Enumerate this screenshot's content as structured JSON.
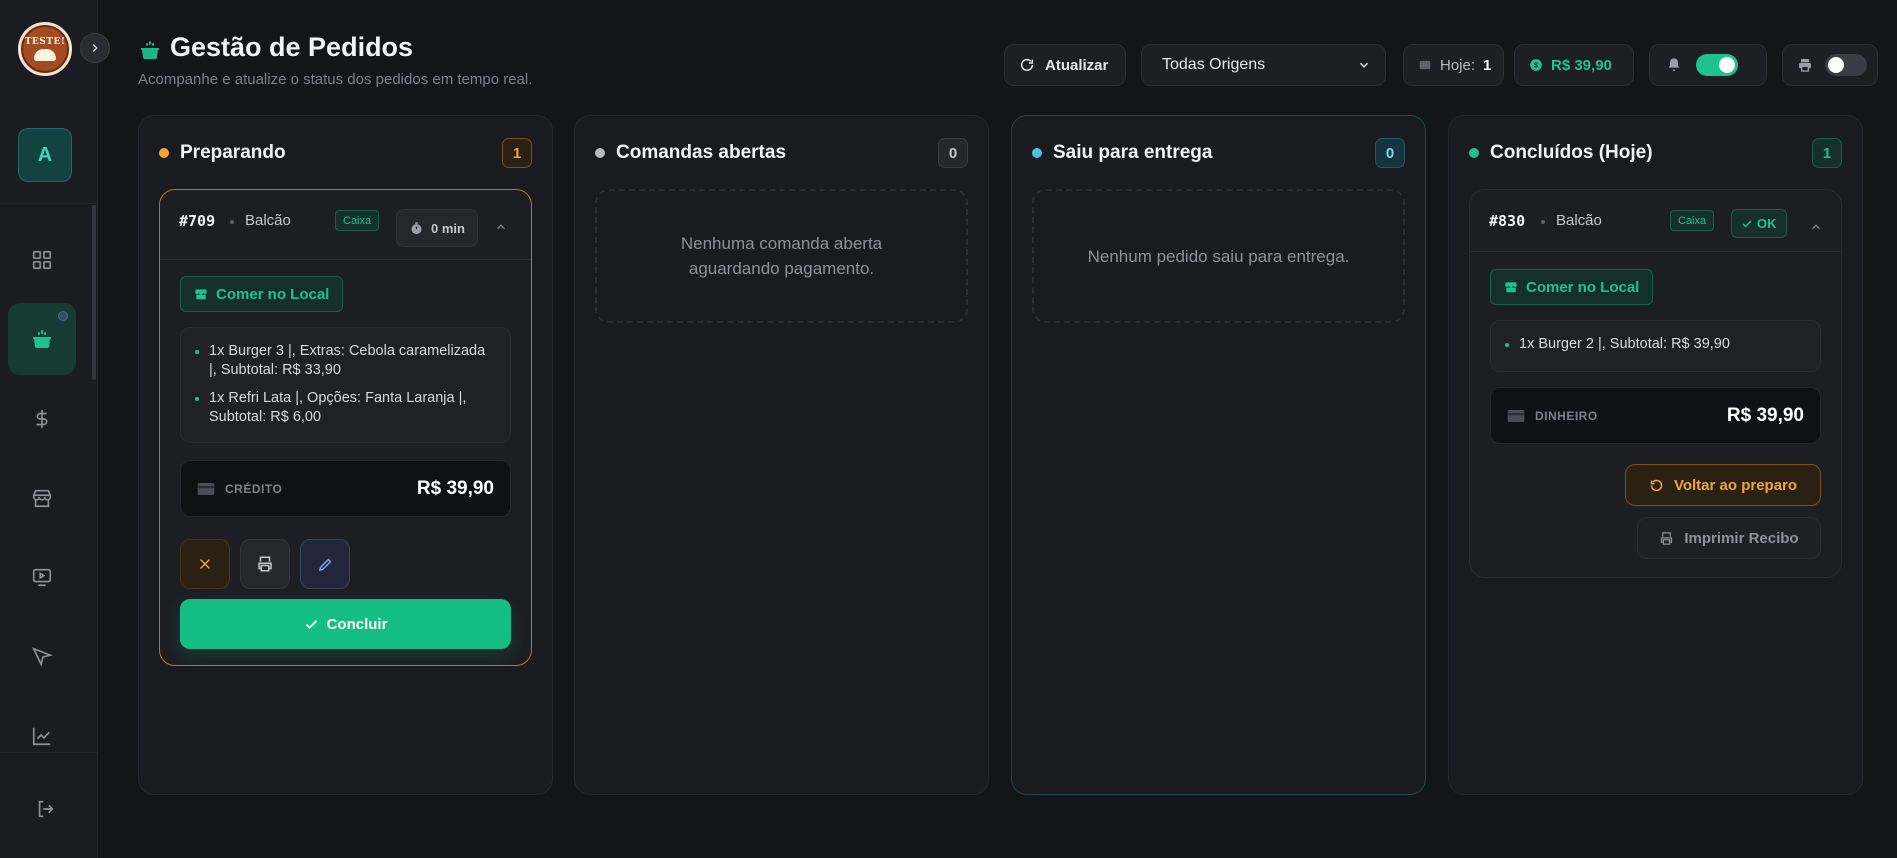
{
  "sidebar": {
    "logo_text": "TESTE!",
    "avatar_initial": "A",
    "nav_icons": [
      "grid-icon",
      "cooking-pot-icon",
      "dollar-icon",
      "store-icon",
      "tv-icon",
      "cursor-icon",
      "chart-icon"
    ],
    "logout_icon": "logout-icon"
  },
  "header": {
    "title": "Gestão de Pedidos",
    "subtitle": "Acompanhe e atualize o status dos pedidos em tempo real.",
    "refresh_label": "Atualizar",
    "origin_select": "Todas Origens",
    "today_label": "Hoje:",
    "today_count": "1",
    "revenue": "R$ 39,90",
    "notifications_enabled": true,
    "auto_print_enabled": false
  },
  "colors": {
    "accent": "#15be85",
    "preparing": "#f0a33a",
    "open": "#b6b9c1",
    "delivery": "#4fc0e0",
    "done": "#1ec28f"
  },
  "columns": {
    "preparing": {
      "title": "Preparando",
      "count": "1",
      "order": {
        "number": "#709",
        "origin": "Balcão",
        "tag": "Caixa",
        "timer": "0 min",
        "place": "Comer no Local",
        "items": [
          "1x Burger 3 |, Extras: Cebola caramelizada |, Subtotal: R$ 33,90",
          "1x Refri Lata |, Opções: Fanta Laranja |, Subtotal: R$ 6,00"
        ],
        "payment_method": "CRÉDITO",
        "total": "R$ 39,90",
        "conclude_label": "Concluir"
      }
    },
    "open_tabs": {
      "title": "Comandas abertas",
      "count": "0",
      "empty_text": "Nenhuma comanda aberta aguardando pagamento."
    },
    "delivery": {
      "title": "Saiu para entrega",
      "count": "0",
      "empty_text": "Nenhum pedido saiu para entrega."
    },
    "done": {
      "title": "Concluídos (Hoje)",
      "count": "1",
      "order": {
        "number": "#830",
        "origin": "Balcão",
        "tag": "Caixa",
        "status": "OK",
        "place": "Comer no Local",
        "items": [
          "1x Burger 2 |, Subtotal: R$ 39,90"
        ],
        "payment_method": "DINHEIRO",
        "total": "R$ 39,90",
        "revert_label": "Voltar ao preparo",
        "receipt_label": "Imprimir Recibo"
      }
    }
  }
}
